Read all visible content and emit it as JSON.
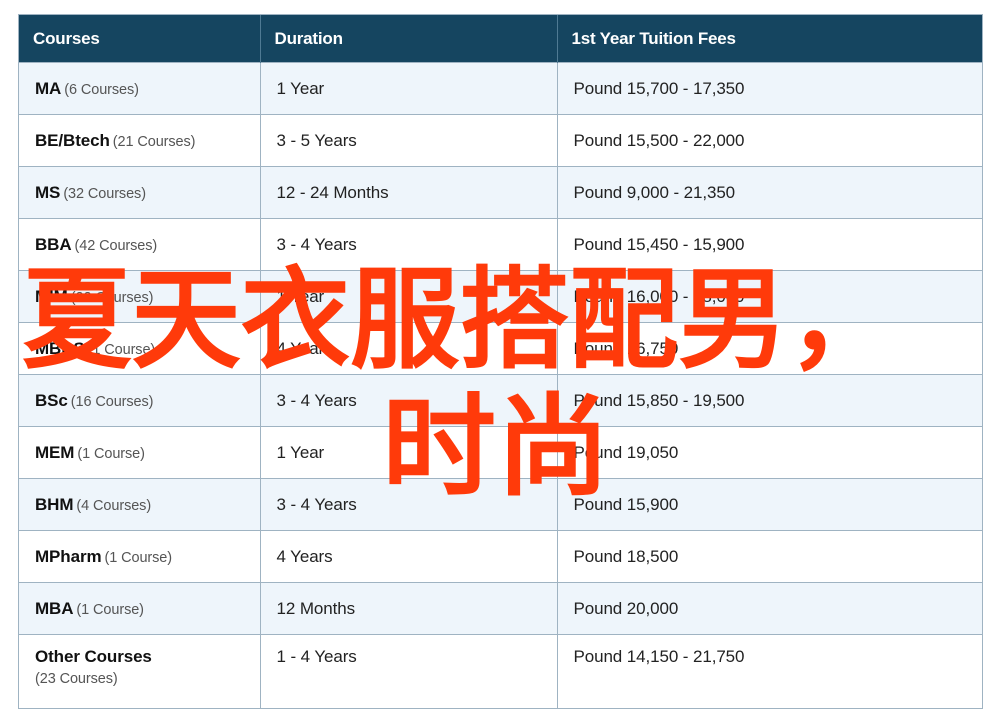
{
  "table": {
    "headers": [
      "Courses",
      "Duration",
      "1st Year Tuition Fees"
    ],
    "rows": [
      {
        "course": "MA",
        "count": "(6 Courses)",
        "duration": "1 Year",
        "fees": "Pound 15,700 - 17,350"
      },
      {
        "course": "BE/Btech",
        "count": "(21 Courses)",
        "duration": "3 - 5 Years",
        "fees": "Pound 15,500 - 22,000"
      },
      {
        "course": "MS",
        "count": "(32 Courses)",
        "duration": "12 - 24 Months",
        "fees": "Pound 9,000 - 21,350"
      },
      {
        "course": "BBA",
        "count": "(42 Courses)",
        "duration": "3 - 4 Years",
        "fees": "Pound 15,450 - 15,900"
      },
      {
        "course": "MIM",
        "count": "(22 Courses)",
        "duration": "1 Year",
        "fees": "Pound 16,000 - 18,000"
      },
      {
        "course": "MBBS",
        "count": "(1 Course)",
        "duration": "4 Years",
        "fees": "Pound 16,750"
      },
      {
        "course": "BSc",
        "count": "(16 Courses)",
        "duration": "3 - 4 Years",
        "fees": "Pound 15,850 - 19,500"
      },
      {
        "course": "MEM",
        "count": "(1 Course)",
        "duration": "1 Year",
        "fees": "Pound 19,050"
      },
      {
        "course": "BHM",
        "count": "(4 Courses)",
        "duration": "3 - 4 Years",
        "fees": "Pound 15,900"
      },
      {
        "course": "MPharm",
        "count": "(1 Course)",
        "duration": "4 Years",
        "fees": "Pound 18,500"
      },
      {
        "course": "MBA",
        "count": "(1 Course)",
        "duration": "12 Months",
        "fees": "Pound 20,000"
      },
      {
        "course": "Other Courses",
        "count": "(23 Courses)",
        "duration": "1 - 4 Years",
        "fees": "Pound 14,150 - 21,750"
      }
    ]
  },
  "overlay": {
    "line1": "夏天衣服搭配男，",
    "line2": "时尚",
    "color": "#ff3a0a"
  },
  "colors": {
    "header_bg": "#154560",
    "header_text": "#ffffff",
    "row_stripe": "#eef5fb",
    "border": "#9fb3c2"
  }
}
